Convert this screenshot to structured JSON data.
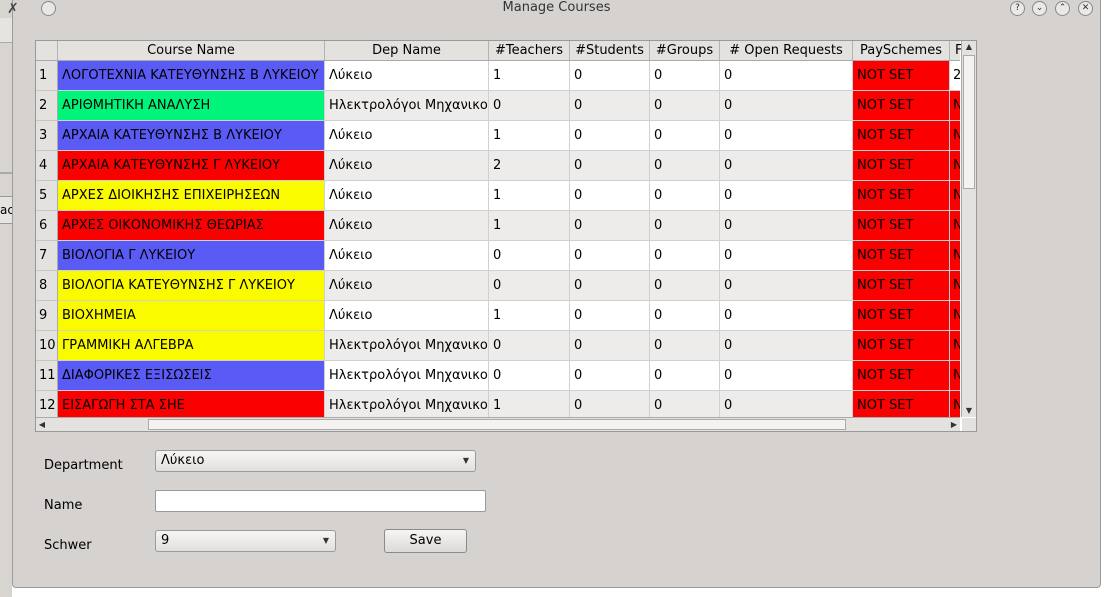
{
  "window": {
    "title": "Manage Courses"
  },
  "background": {
    "snippet": "ac"
  },
  "table": {
    "columns": [
      "Course Name",
      "Dep Name",
      "#Teachers",
      "#Students",
      "#Groups",
      "# Open Requests",
      "PaySchemes",
      "F"
    ],
    "rows": [
      {
        "num": "1",
        "name": " ΛΟΓΟΤΕΧΝΙΑ ΚΑΤΕΥΘΥΝΣΗΣ Β ΛΥΚΕΙΟΥ",
        "color": "#5a5af5",
        "dep": "Λύκειο",
        "teachers": "1",
        "students": "0",
        "groups": "0",
        "requests": "0",
        "pay": "NOT SET",
        "extra": "2"
      },
      {
        "num": "2",
        "name": "ΑΡΙΘΜΗΤΙΚΗ ΑΝΑΛΥΣΗ",
        "color": "#00f47a",
        "dep": "Ηλεκτρολόγοι Μηχανικοί",
        "teachers": "0",
        "students": "0",
        "groups": "0",
        "requests": "0",
        "pay": "NOT SET",
        "extra": "N"
      },
      {
        "num": "3",
        "name": "ΑΡΧΑΙΑ ΚΑΤΕΥΘΥΝΣΗΣ Β ΛΥΚΕΙΟΥ",
        "color": "#5a5af5",
        "dep": "Λύκειο",
        "teachers": "1",
        "students": "0",
        "groups": "0",
        "requests": "0",
        "pay": "NOT SET",
        "extra": "N"
      },
      {
        "num": "4",
        "name": "ΑΡΧΑΙΑ ΚΑΤΕΥΘΥΝΣΗΣ Γ ΛΥΚΕΙΟΥ",
        "color": "#fb0000",
        "dep": "Λύκειο",
        "teachers": "2",
        "students": "0",
        "groups": "0",
        "requests": "0",
        "pay": "NOT SET",
        "extra": "N"
      },
      {
        "num": "5",
        "name": "ΑΡΧΕΣ ΔΙΟΙΚΗΣΗΣ ΕΠΙΧΕΙΡΗΣΕΩΝ",
        "color": "#fbfb00",
        "dep": "Λύκειο",
        "teachers": "1",
        "students": "0",
        "groups": "0",
        "requests": "0",
        "pay": "NOT SET",
        "extra": "N"
      },
      {
        "num": "6",
        "name": "ΑΡΧΕΣ ΟΙΚΟΝΟΜΙΚΗΣ ΘΕΩΡΙΑΣ",
        "color": "#fb0000",
        "dep": "Λύκειο",
        "teachers": "1",
        "students": "0",
        "groups": "0",
        "requests": "0",
        "pay": "NOT SET",
        "extra": "N"
      },
      {
        "num": "7",
        "name": "ΒΙΟΛΟΓΙΑ Γ ΛΥΚΕΙΟΥ",
        "color": "#5a5af5",
        "dep": "Λύκειο",
        "teachers": "0",
        "students": "0",
        "groups": "0",
        "requests": "0",
        "pay": "NOT SET",
        "extra": "N"
      },
      {
        "num": "8",
        "name": "ΒΙΟΛΟΓΙΑ ΚΑΤΕΥΘΥΝΣΗΣ Γ ΛΥΚΕΙΟΥ",
        "color": "#fbfb00",
        "dep": "Λύκειο",
        "teachers": "0",
        "students": "0",
        "groups": "0",
        "requests": "0",
        "pay": "NOT SET",
        "extra": "N"
      },
      {
        "num": "9",
        "name": "ΒΙΟΧΗΜΕΙΑ",
        "color": "#fbfb00",
        "dep": "Λύκειο",
        "teachers": "1",
        "students": "0",
        "groups": "0",
        "requests": "0",
        "pay": "NOT SET",
        "extra": "N"
      },
      {
        "num": "10",
        "name": "ΓΡΑΜΜΙΚΗ ΑΛΓΕΒΡΑ",
        "color": "#fbfb00",
        "dep": "Ηλεκτρολόγοι Μηχανικοί",
        "teachers": "0",
        "students": "0",
        "groups": "0",
        "requests": "0",
        "pay": "NOT SET",
        "extra": "N"
      },
      {
        "num": "11",
        "name": "ΔΙΑΦΟΡΙΚΕΣ ΕΞΙΣΩΣΕΙΣ",
        "color": "#5a5af5",
        "dep": "Ηλεκτρολόγοι Μηχανικοί",
        "teachers": "0",
        "students": "0",
        "groups": "0",
        "requests": "0",
        "pay": "NOT SET",
        "extra": "N"
      },
      {
        "num": "12",
        "name": "ΕΙΣΑΓΩΓΗ ΣΤΑ ΣΗΕ",
        "color": "#fb0000",
        "dep": "Ηλεκτρολόγοι Μηχανικοί",
        "teachers": "1",
        "students": "0",
        "groups": "0",
        "requests": "0",
        "pay": "NOT SET",
        "extra": "N"
      }
    ],
    "pay_color": "#fb0000"
  },
  "form": {
    "department_label": "Department",
    "department_value": "Λύκειο",
    "name_label": "Name",
    "name_value": "",
    "schwer_label": "Schwer",
    "schwer_value": "9",
    "save_label": "Save"
  },
  "icons": {
    "app": "app-icon",
    "help": "help-icon",
    "minimize": "minimize-icon",
    "maximize": "maximize-icon",
    "close": "close-icon"
  }
}
